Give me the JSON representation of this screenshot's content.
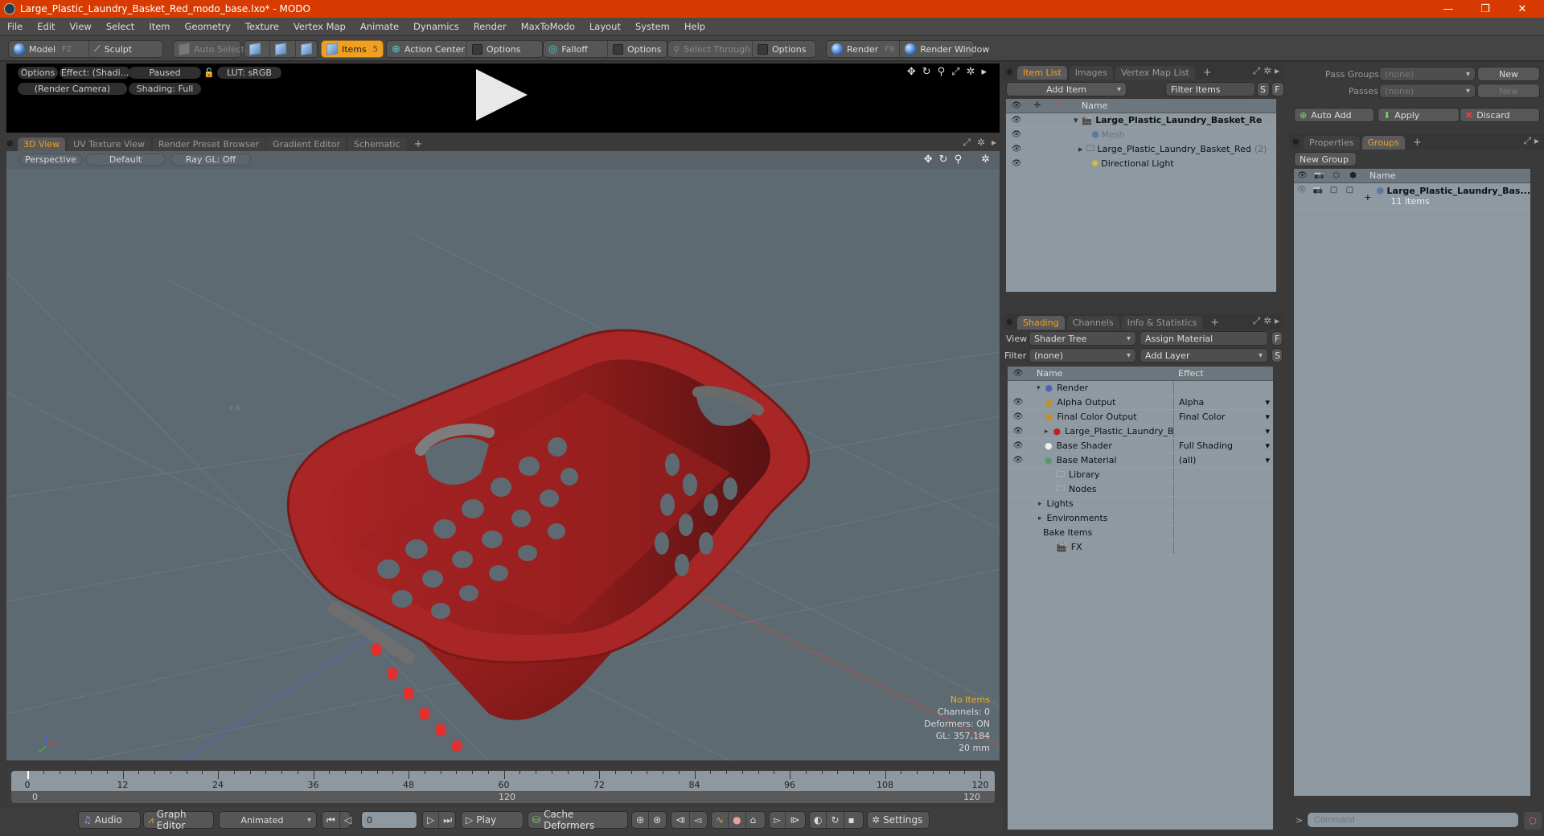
{
  "window": {
    "title": "Large_Plastic_Laundry_Basket_Red_modo_base.lxo* - MODO",
    "controls": {
      "minimize": "—",
      "maximize": "❐",
      "close": "✕"
    }
  },
  "menu": [
    "File",
    "Edit",
    "View",
    "Select",
    "Item",
    "Geometry",
    "Texture",
    "Vertex Map",
    "Animate",
    "Dynamics",
    "Render",
    "MaxToModo",
    "Layout",
    "System",
    "Help"
  ],
  "toolbar": {
    "model": "Model",
    "model_key": "F2",
    "sculpt": "Sculpt",
    "auto_select": "Auto Select",
    "items": "Items",
    "items_key": "5",
    "action_center": "Action Center",
    "options1": "Options",
    "falloff": "Falloff",
    "options2": "Options",
    "select_through": "Select Through",
    "options3": "Options",
    "render": "Render",
    "render_key": "F9",
    "render_window": "Render Window"
  },
  "render_preview": {
    "options": "Options",
    "effect": "Effect: (Shadi...",
    "status": "Paused",
    "lut": "LUT: sRGB",
    "camera": "(Render Camera)",
    "shading": "Shading: Full"
  },
  "viewport_tabs": [
    "3D View",
    "UV Texture View",
    "Render Preset Browser",
    "Gradient Editor",
    "Schematic"
  ],
  "viewport": {
    "projection": "Perspective",
    "style": "Default",
    "raygl": "Ray GL: Off",
    "hud": {
      "selection": "No Items",
      "channels": "Channels: 0",
      "deformers": "Deformers: ON",
      "gl": "GL: 357,184",
      "scale": "20 mm"
    }
  },
  "timeline": {
    "ticks": [
      "0",
      "12",
      "24",
      "36",
      "48",
      "60",
      "72",
      "84",
      "96",
      "108",
      "120"
    ],
    "range_start": "0",
    "range_mid": "120",
    "range_end": "120",
    "current_frame": "0"
  },
  "transport": {
    "audio": "Audio",
    "graph_editor": "Graph Editor",
    "mode": "Animated",
    "frame": "0",
    "play": "Play",
    "cache_deformers": "Cache Deformers",
    "settings": "Settings"
  },
  "item_list": {
    "tabs": [
      "Item List",
      "Images",
      "Vertex Map List"
    ],
    "add_item": "Add Item",
    "filter": "Filter Items",
    "s": "S",
    "f": "F",
    "header_name": "Name",
    "rows": [
      {
        "name": "Large_Plastic_Laundry_Basket_Re",
        "bold": true,
        "icon": "scene-icon"
      },
      {
        "name": "Mesh",
        "dim": true,
        "icon": "mesh-icon"
      },
      {
        "name": "Large_Plastic_Laundry_Basket_Red",
        "count": "(2)",
        "icon": "group-folder-icon"
      },
      {
        "name": "Directional Light",
        "icon": "light-icon"
      }
    ]
  },
  "shading": {
    "tabs": [
      "Shading",
      "Channels",
      "Info & Statistics"
    ],
    "view_label": "View",
    "view_value": "Shader Tree",
    "assign_material": "Assign Material",
    "f": "F",
    "filter_label": "Filter",
    "filter_value": "(none)",
    "add_layer": "Add Layer",
    "s": "S",
    "header_name": "Name",
    "header_effect": "Effect",
    "rows": [
      {
        "name": "Render",
        "effect": "",
        "indent": 0,
        "icon": "render-sphere-icon"
      },
      {
        "name": "Alpha Output",
        "effect": "Alpha",
        "indent": 1,
        "icon": "output-icon"
      },
      {
        "name": "Final Color Output",
        "effect": "Final Color",
        "indent": 1,
        "icon": "output-icon"
      },
      {
        "name": "Large_Plastic_Laundry_Bas ...",
        "effect": "",
        "indent": 1,
        "icon": "material-group-icon"
      },
      {
        "name": "Base Shader",
        "effect": "Full Shading",
        "indent": 1,
        "icon": "shader-icon"
      },
      {
        "name": "Base Material",
        "effect": "(all)",
        "indent": 1,
        "icon": "material-icon"
      },
      {
        "name": "Library",
        "effect": "",
        "indent": 2,
        "icon": "folder-icon"
      },
      {
        "name": "Nodes",
        "effect": "",
        "indent": 2,
        "icon": "folder-icon"
      },
      {
        "name": "Lights",
        "effect": "",
        "indent": 3,
        "icon": ""
      },
      {
        "name": "Environments",
        "effect": "",
        "indent": 3,
        "icon": ""
      },
      {
        "name": "Bake Items",
        "effect": "",
        "indent": 3,
        "icon": ""
      },
      {
        "name": "FX",
        "effect": "",
        "indent": 2,
        "icon": "fx-icon"
      }
    ]
  },
  "pass_panel": {
    "pass_groups_label": "Pass Groups",
    "pass_groups_value": "(none)",
    "new1": "New",
    "passes_label": "Passes",
    "passes_value": "(none)",
    "new2": "New",
    "auto_add": "Auto Add",
    "apply": "Apply",
    "discard": "Discard"
  },
  "groups_panel": {
    "tabs": [
      "Properties",
      "Groups"
    ],
    "new_group": "New Group",
    "header_name": "Name",
    "group_name": "Large_Plastic_Laundry_Bas...",
    "group_count": "11 Items"
  },
  "command": {
    "prompt": ">",
    "placeholder": "Command"
  }
}
